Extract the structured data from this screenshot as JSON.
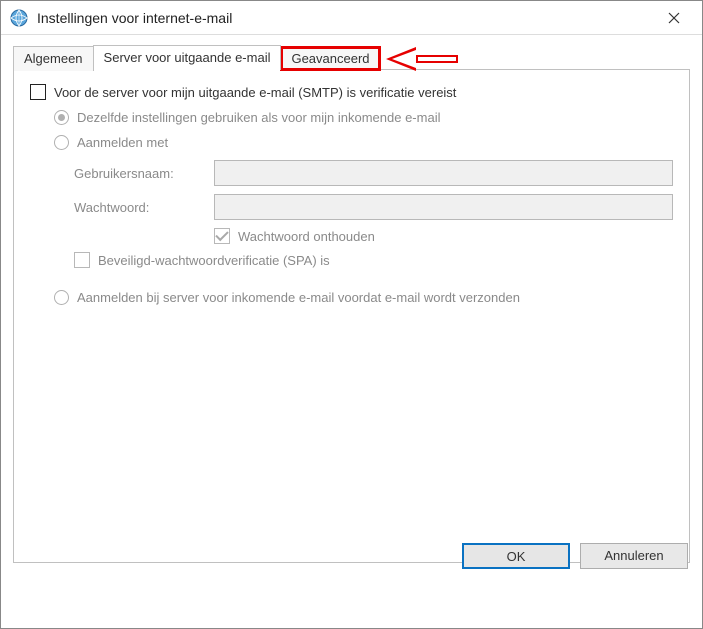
{
  "window": {
    "title": "Instellingen voor internet-e-mail"
  },
  "tabs": {
    "general": "Algemeen",
    "outgoing": "Server voor uitgaande e-mail",
    "advanced": "Geavanceerd"
  },
  "panel": {
    "main_checkbox": "Voor de server voor mijn uitgaande e-mail (SMTP) is verificatie vereist",
    "radio_same": "Dezelfde instellingen gebruiken als voor mijn inkomende e-mail",
    "radio_login": "Aanmelden met",
    "username_label": "Gebruikersnaam:",
    "password_label": "Wachtwoord:",
    "remember_pw": "Wachtwoord onthouden",
    "spa_checkbox": "Beveiligd-wachtwoordverificatie (SPA) is",
    "radio_incoming_first": "Aanmelden bij server voor inkomende e-mail voordat e-mail wordt verzonden"
  },
  "buttons": {
    "ok": "OK",
    "cancel": "Annuleren"
  }
}
